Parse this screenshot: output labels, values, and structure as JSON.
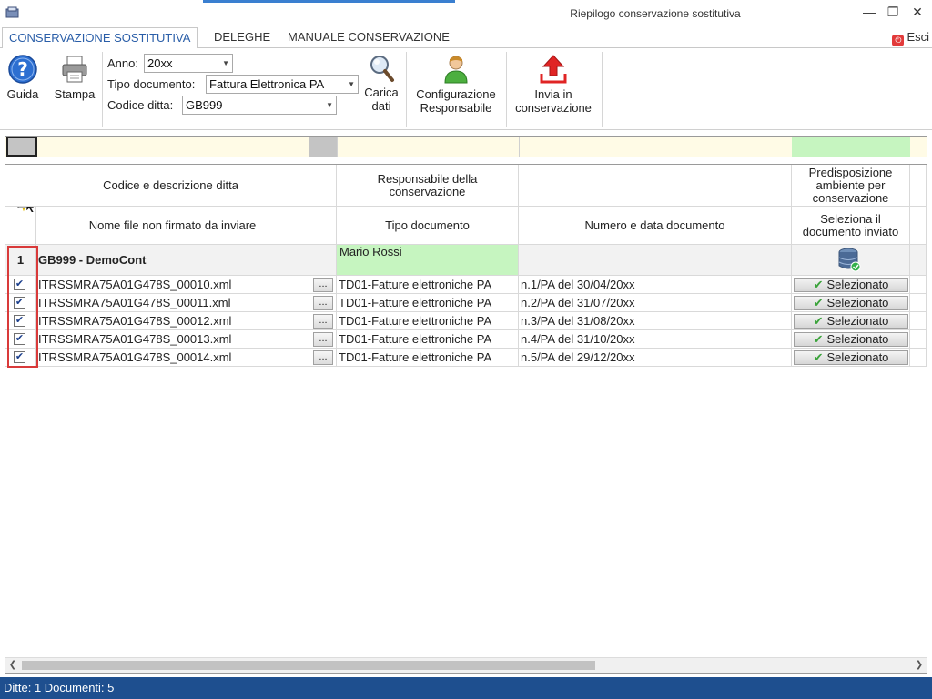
{
  "window": {
    "title": "Riepilogo conservazione sostitutiva",
    "minimize": "—",
    "restore": "❐",
    "close": "✕"
  },
  "tabs": [
    {
      "label": "CONSERVAZIONE SOSTITUTIVA",
      "active": true
    },
    {
      "label": "DELEGHE",
      "active": false
    },
    {
      "label": "MANUALE CONSERVAZIONE",
      "active": false
    }
  ],
  "esci_label": "Esci",
  "ribbon": {
    "guida_label": "Guida",
    "stampa_label": "Stampa",
    "anno_label": "Anno:",
    "anno_value": "20xx",
    "tipo_label": "Tipo documento:",
    "tipo_value": "Fattura Elettronica PA",
    "codice_label": "Codice ditta:",
    "codice_value": "GB999",
    "carica_line1": "Carica",
    "carica_line2": "dati",
    "config_line1": "Configurazione",
    "config_line2": "Responsabile",
    "invia_line1": "Invia in",
    "invia_line2": "conservazione"
  },
  "grid": {
    "headers": {
      "codice_descrizione": "Codice e descrizione ditta",
      "responsabile": "Responsabile della conservazione",
      "predisposizione": "Predisposizione ambiente per conservazione",
      "nome_file": "Nome file non firmato da inviare",
      "tipo_documento": "Tipo documento",
      "numero_data": "Numero e data documento",
      "seleziona": "Seleziona il documento inviato"
    },
    "group": {
      "index": "1",
      "ditta": "GB999 - DemoCont",
      "responsabile": "Mario Rossi"
    },
    "dots_label": "...",
    "select_label": "Selezionato",
    "rows": [
      {
        "file": "ITRSSMRA75A01G478S_00010.xml",
        "tipo": "TD01-Fatture elettroniche PA",
        "numero": "n.1/PA del 30/04/20xx"
      },
      {
        "file": "ITRSSMRA75A01G478S_00011.xml",
        "tipo": "TD01-Fatture elettroniche PA",
        "numero": "n.2/PA del 31/07/20xx"
      },
      {
        "file": "ITRSSMRA75A01G478S_00012.xml",
        "tipo": "TD01-Fatture elettroniche PA",
        "numero": "n.3/PA del 31/08/20xx"
      },
      {
        "file": "ITRSSMRA75A01G478S_00013.xml",
        "tipo": "TD01-Fatture elettroniche PA",
        "numero": "n.4/PA del 31/10/20xx"
      },
      {
        "file": "ITRSSMRA75A01G478S_00014.xml",
        "tipo": "TD01-Fatture elettroniche PA",
        "numero": "n.5/PA del 29/12/20xx"
      }
    ]
  },
  "status_text": "Ditte: 1 Documenti: 5",
  "colors": {
    "accent": "#2a5ea8",
    "status_bar": "#1e4f8f",
    "highlight_green": "#c6f5c0",
    "highlight_yellow": "#fffbe6",
    "red_marker": "#d93a3a"
  }
}
